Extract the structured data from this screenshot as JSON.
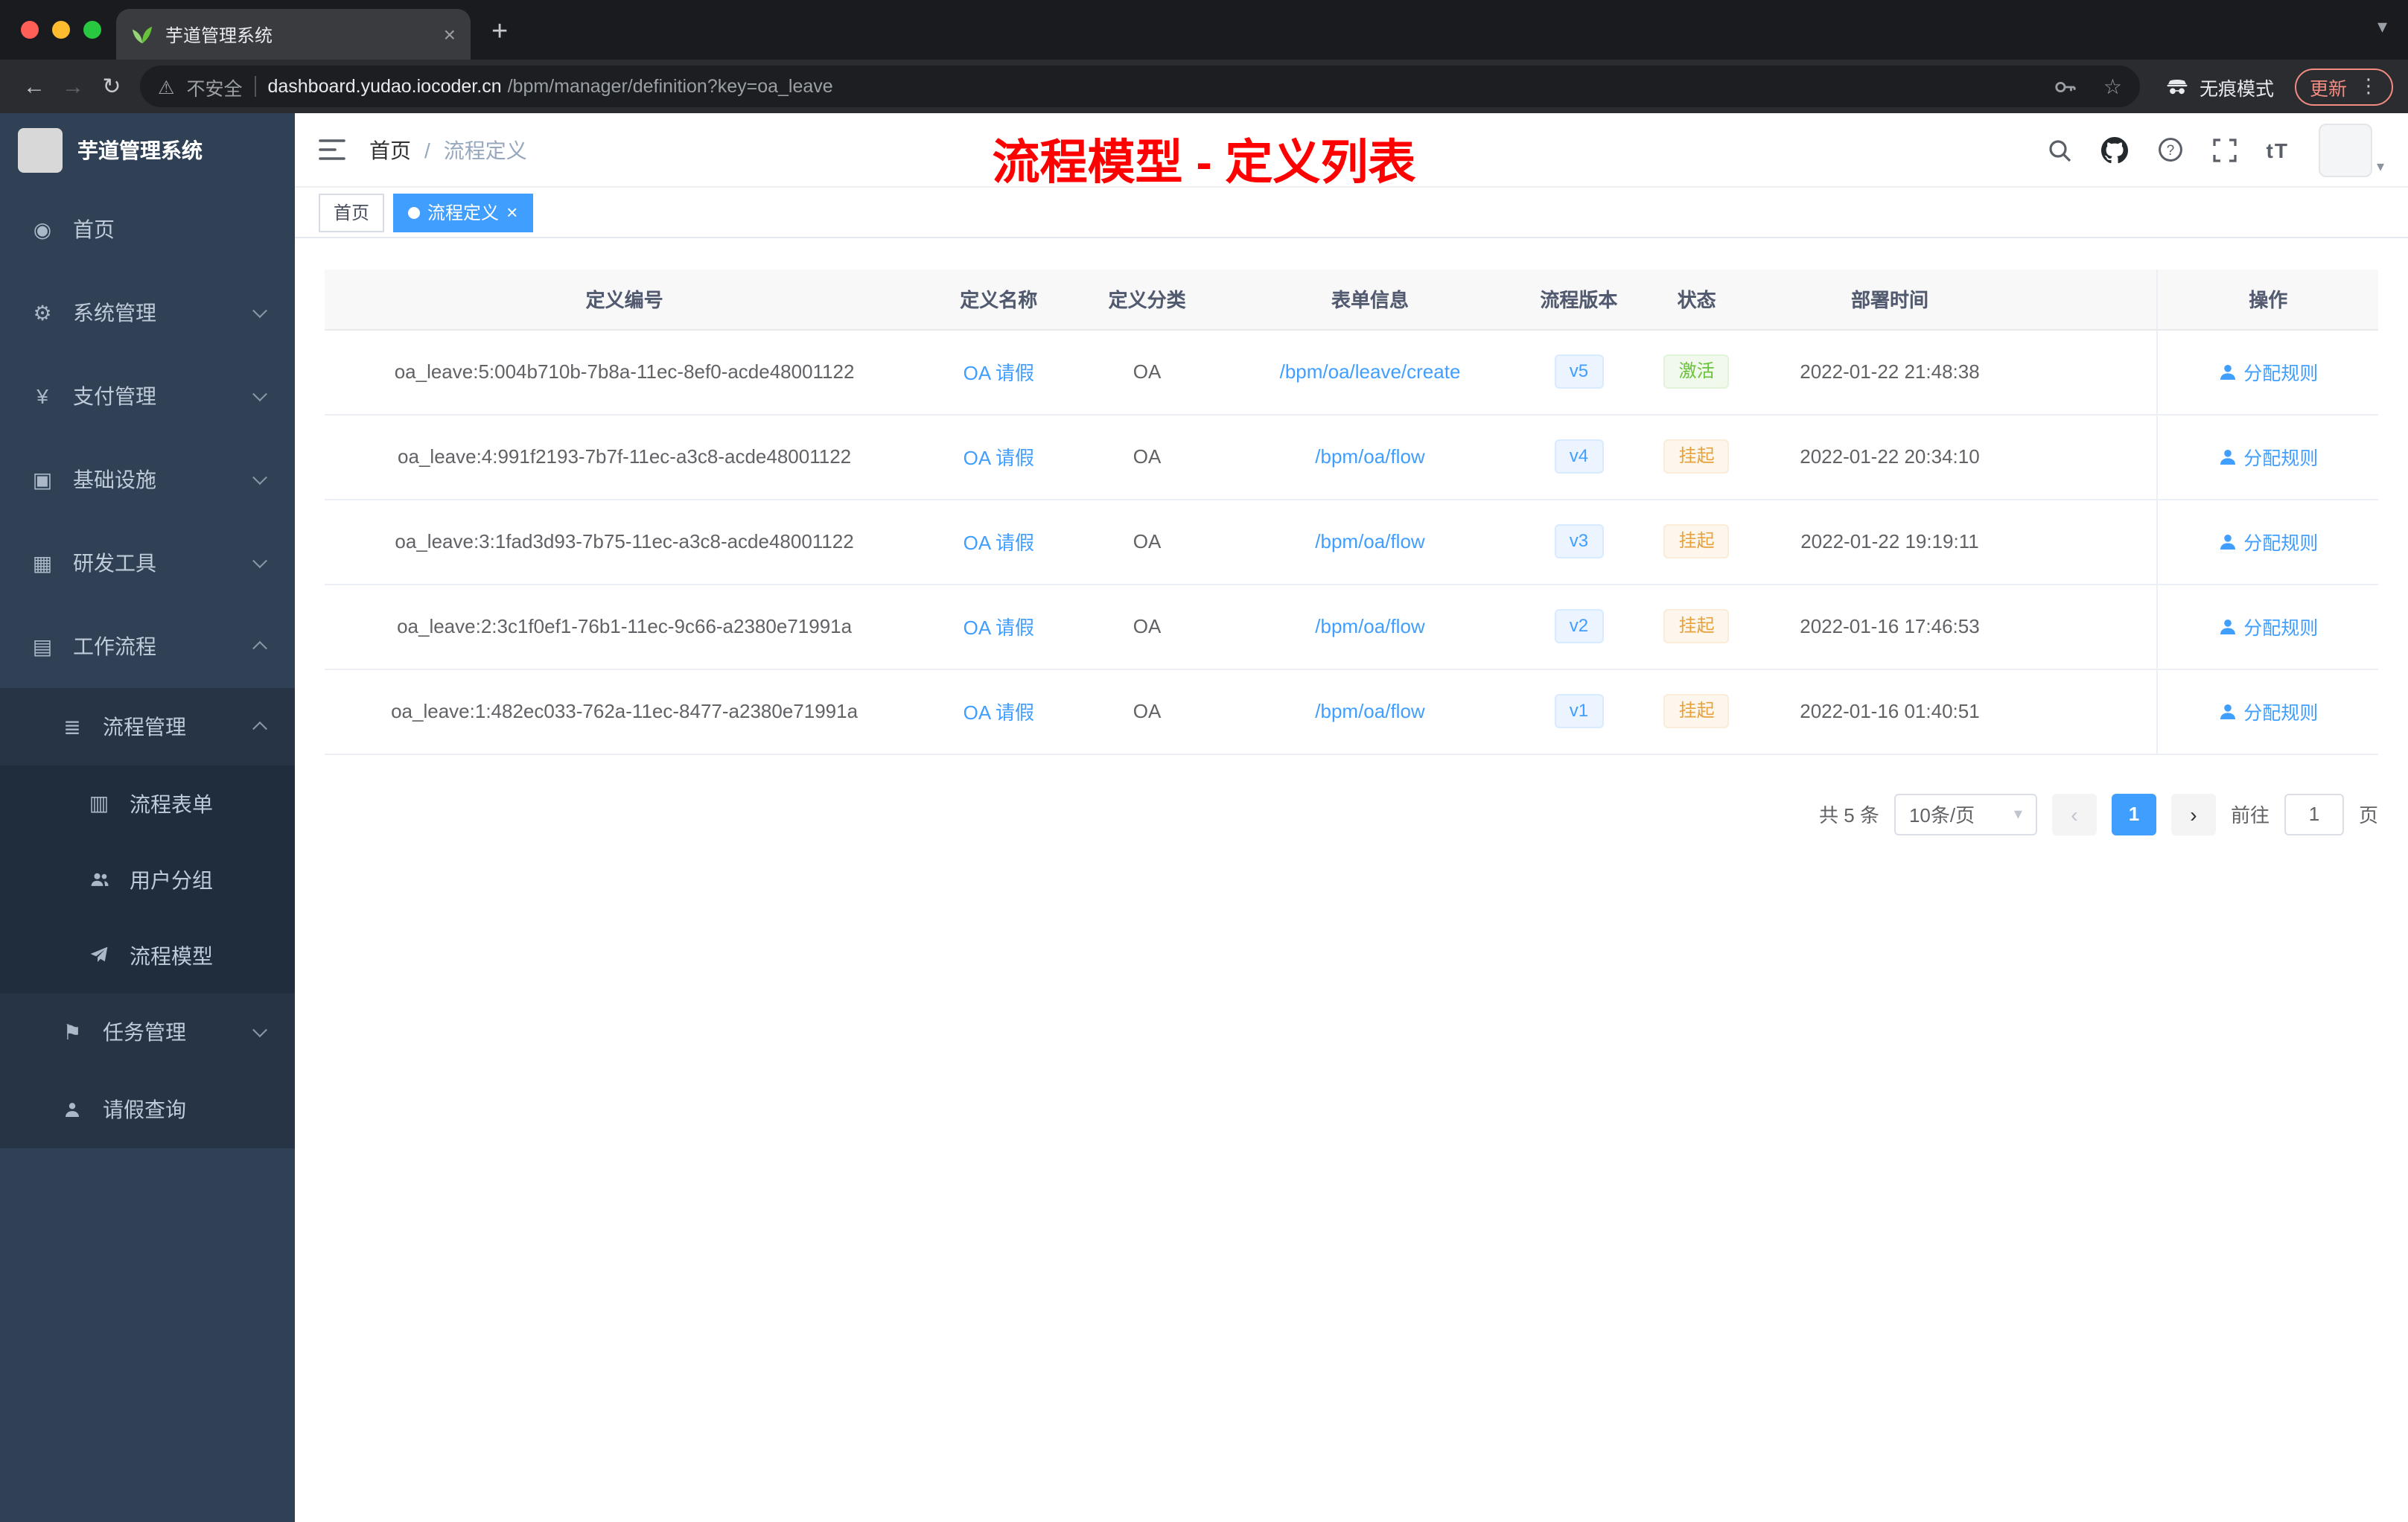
{
  "colors": {
    "accent_blue": "#409eff",
    "success_green": "#67c23a",
    "warning_orange": "#e6a23c",
    "title_red": "#ff0000",
    "sidebar_bg": "#304156"
  },
  "browser": {
    "tab_title": "芋道管理系统",
    "security_label": "不安全",
    "url_host": "dashboard.yudao.iocoder.cn",
    "url_path": "/bpm/manager/definition?key=oa_leave",
    "incognito_label": "无痕模式",
    "update_label": "更新"
  },
  "icons": {
    "back": "←",
    "forward": "→",
    "reload": "↻",
    "warning": "⚠",
    "star": "☆",
    "more_vertical": "⋮",
    "new_tab": "+",
    "close": "×",
    "caret_down": "▾",
    "dashboard": "◉",
    "gear": "⚙",
    "yen": "¥",
    "infra": "▣",
    "tools": "▦",
    "workflow": "▤",
    "list": "≣",
    "form": "▥",
    "flag": "⚑",
    "question": "?",
    "font_size": "tT"
  },
  "sidebar": {
    "logo_title": "芋道管理系统",
    "items": {
      "home": "首页",
      "system": "系统管理",
      "payment": "支付管理",
      "infrastructure": "基础设施",
      "devtools": "研发工具",
      "workflow": "工作流程",
      "process_mgmt": "流程管理",
      "process_form": "流程表单",
      "user_group": "用户分组",
      "process_model": "流程模型",
      "task_mgmt": "任务管理",
      "leave_query": "请假查询"
    }
  },
  "header": {
    "breadcrumb_home": "首页",
    "breadcrumb_sep": "/",
    "breadcrumb_current": "流程定义",
    "overlay_title": "流程模型 - 定义列表"
  },
  "tags": {
    "home": "首页",
    "current": "流程定义"
  },
  "table": {
    "columns": {
      "id": "定义编号",
      "name": "定义名称",
      "category": "定义分类",
      "form": "表单信息",
      "version": "流程版本",
      "status": "状态",
      "time": "部署时间",
      "action": "操作"
    },
    "rows": [
      {
        "id": "oa_leave:5:004b710b-7b8a-11ec-8ef0-acde48001122",
        "name": "OA 请假",
        "category": "OA",
        "form": "/bpm/oa/leave/create",
        "version": "v5",
        "status": "激活",
        "time": "2022-01-22 21:48:38",
        "action": "分配规则"
      },
      {
        "id": "oa_leave:4:991f2193-7b7f-11ec-a3c8-acde48001122",
        "name": "OA 请假",
        "category": "OA",
        "form": "/bpm/oa/flow",
        "version": "v4",
        "status": "挂起",
        "time": "2022-01-22 20:34:10",
        "action": "分配规则"
      },
      {
        "id": "oa_leave:3:1fad3d93-7b75-11ec-a3c8-acde48001122",
        "name": "OA 请假",
        "category": "OA",
        "form": "/bpm/oa/flow",
        "version": "v3",
        "status": "挂起",
        "time": "2022-01-22 19:19:11",
        "action": "分配规则"
      },
      {
        "id": "oa_leave:2:3c1f0ef1-76b1-11ec-9c66-a2380e71991a",
        "name": "OA 请假",
        "category": "OA",
        "form": "/bpm/oa/flow",
        "version": "v2",
        "status": "挂起",
        "time": "2022-01-16 17:46:53",
        "action": "分配规则"
      },
      {
        "id": "oa_leave:1:482ec033-762a-11ec-8477-a2380e71991a",
        "name": "OA 请假",
        "category": "OA",
        "form": "/bpm/oa/flow",
        "version": "v1",
        "status": "挂起",
        "time": "2022-01-16 01:40:51",
        "action": "分配规则"
      }
    ]
  },
  "pagination": {
    "total": "共 5 条",
    "page_size": "10条/页",
    "prev": "‹",
    "page_1": "1",
    "next": "›",
    "goto_label": "前往",
    "goto_value": "1",
    "page_unit": "页"
  }
}
